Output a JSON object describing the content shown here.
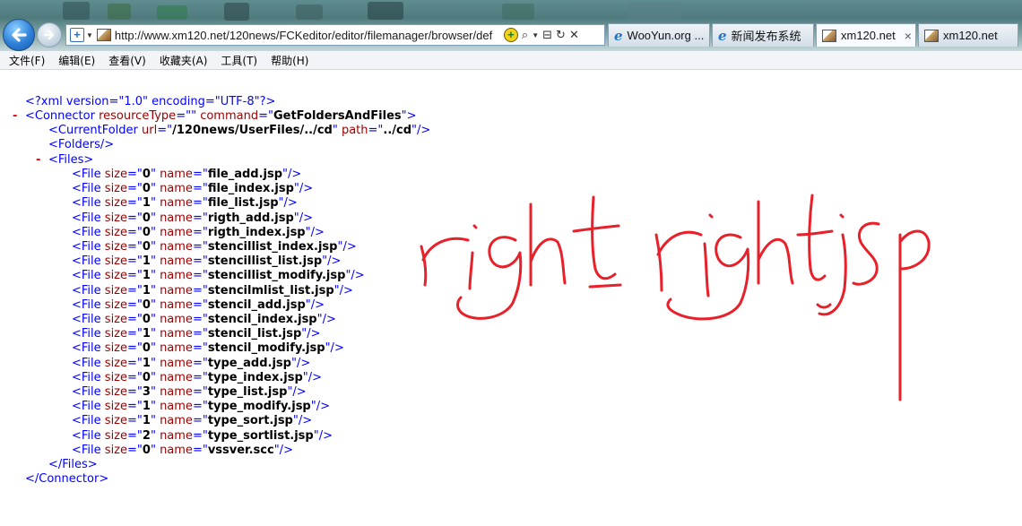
{
  "browser": {
    "url": "http://www.xm120.net/120news/FCKeditor/editor/filemanager/browser/def",
    "tabs": [
      {
        "label": "WooYun.org ...",
        "icon": "ie-page-icon",
        "active": false
      },
      {
        "label": "新闻发布系统",
        "icon": "ie-page-icon",
        "active": false
      },
      {
        "label": "xm120.net",
        "icon": "site-favicon",
        "active": true
      },
      {
        "label": "xm120.net",
        "icon": "site-favicon",
        "active": false
      }
    ],
    "tab_close_glyph": "×",
    "menu": [
      "文件(F)",
      "编辑(E)",
      "查看(V)",
      "收藏夹(A)",
      "工具(T)",
      "帮助(H)"
    ],
    "icons": [
      "back-arrow-icon",
      "forward-arrow-icon",
      "compatibility-view-icon",
      "addon-icon",
      "search-icon",
      "refresh-icon",
      "stop-icon",
      "close-icon"
    ]
  },
  "xml": {
    "declaration": "<?xml version=\"1.0\" encoding=\"UTF-8\"?>",
    "connector": {
      "resourceType": "",
      "command": "GetFoldersAndFiles"
    },
    "current_folder": {
      "url": "/120news/UserFiles/../cd",
      "path": "../cd"
    },
    "folders_tag": "Folders",
    "files": [
      {
        "size": "0",
        "name": "file_add.jsp"
      },
      {
        "size": "0",
        "name": "file_index.jsp"
      },
      {
        "size": "1",
        "name": "file_list.jsp"
      },
      {
        "size": "0",
        "name": "rigth_add.jsp"
      },
      {
        "size": "0",
        "name": "rigth_index.jsp"
      },
      {
        "size": "0",
        "name": "stencillist_index.jsp"
      },
      {
        "size": "1",
        "name": "stencillist_list.jsp"
      },
      {
        "size": "1",
        "name": "stencillist_modify.jsp"
      },
      {
        "size": "1",
        "name": "stencilmlist_list.jsp"
      },
      {
        "size": "0",
        "name": "stencil_add.jsp"
      },
      {
        "size": "0",
        "name": "stencil_index.jsp"
      },
      {
        "size": "1",
        "name": "stencil_list.jsp"
      },
      {
        "size": "0",
        "name": "stencil_modify.jsp"
      },
      {
        "size": "1",
        "name": "type_add.jsp"
      },
      {
        "size": "0",
        "name": "type_index.jsp"
      },
      {
        "size": "3",
        "name": "type_list.jsp"
      },
      {
        "size": "1",
        "name": "type_modify.jsp"
      },
      {
        "size": "1",
        "name": "type_sort.jsp"
      },
      {
        "size": "2",
        "name": "type_sortlist.jsp"
      },
      {
        "size": "0",
        "name": "vssver.scc"
      }
    ]
  },
  "annotation": {
    "handwritten_text": "rigth_right.jsp",
    "ink_color": "#e8202a"
  },
  "colors": {
    "xml_tag": "#0000ff",
    "xml_attr_name": "#990000",
    "xml_attr_value": "#000000",
    "xml_collapse_marker": "#ff0000"
  }
}
